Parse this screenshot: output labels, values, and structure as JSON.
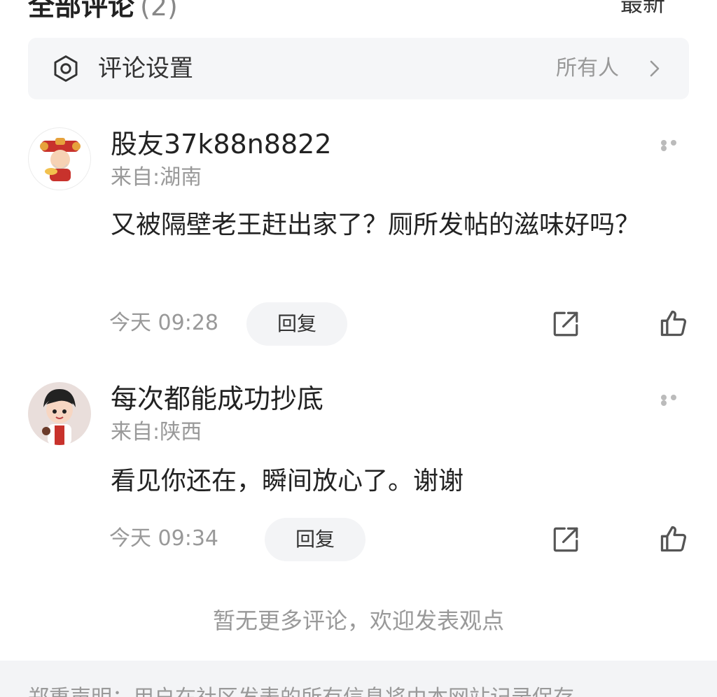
{
  "header": {
    "title": "全部评论",
    "count": "(2)",
    "sort_label": "最新"
  },
  "settings": {
    "label": "评论设置",
    "value": "所有人"
  },
  "comments": [
    {
      "username": "股友37k88n8822",
      "location": "来自:湖南",
      "text": "又被隔壁老王赶出家了？厕所发帖的滋味好吗？",
      "time": "今天 09:28",
      "reply_label": "回复"
    },
    {
      "username": "每次都能成功抄底",
      "location": "来自:陕西",
      "text": "看见你还在，瞬间放心了。谢谢",
      "time": "今天 09:34",
      "reply_label": "回复"
    }
  ],
  "end_note": "暂无更多评论，欢迎发表观点",
  "footer": {
    "text": "郑重声明：用户在社区发表的所有信息将由本网站记录保存"
  }
}
